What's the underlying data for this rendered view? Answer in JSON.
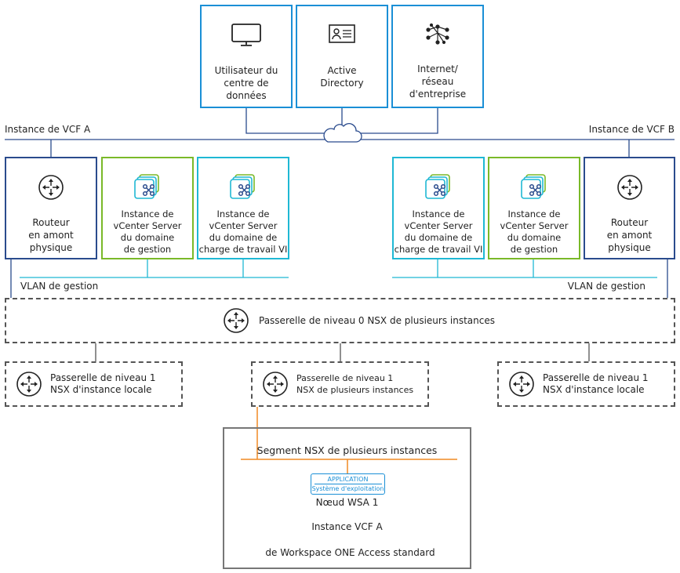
{
  "top_boxes": [
    {
      "label": "Utilisateur du\ncentre de\ndonnées",
      "icon": "monitor-icon"
    },
    {
      "label": "Active\nDirectory",
      "icon": "id-card-icon"
    },
    {
      "label": "Internet/\nréseau\nd'entreprise",
      "icon": "network-icon"
    }
  ],
  "instance_a": "Instance de VCF A",
  "instance_b": "Instance de VCF B",
  "site_a": {
    "router": "Routeur\nen amont\nphysique",
    "vc_mgmt": "Instance de\nvCenter Server\ndu domaine\nde gestion",
    "vc_vi": "Instance de\nvCenter Server\ndu domaine de\ncharge de travail VI",
    "vlan": "VLAN de gestion"
  },
  "site_b": {
    "router": "Routeur\nen amont\nphysique",
    "vc_mgmt": "Instance de\nvCenter Server\ndu domaine\nde gestion",
    "vc_vi": "Instance de\nvCenter Server\ndu domaine de\ncharge de travail VI",
    "vlan": "VLAN de gestion"
  },
  "tier0": "Passerelle de niveau 0 NSX de plusieurs instances",
  "tier1": [
    "Passerelle de niveau 1\n NSX d'instance locale",
    "Passerelle de niveau 1\nNSX de plusieurs instances",
    "Passerelle de niveau 1\nNSX d'instance locale"
  ],
  "wsa": {
    "segment": "Segment NSX de plusieurs instances",
    "app": "APPLICATION",
    "os": "Système d'exploitation",
    "node": "Nœud WSA 1",
    "instance": "Instance VCF A",
    "product": "de Workspace ONE Access standard"
  },
  "colors": {
    "top": "#1a8fd6",
    "router": "#2a4b8d",
    "mgmt": "#7ab929",
    "vi": "#1fb8d4",
    "segment": "#f08a24"
  }
}
